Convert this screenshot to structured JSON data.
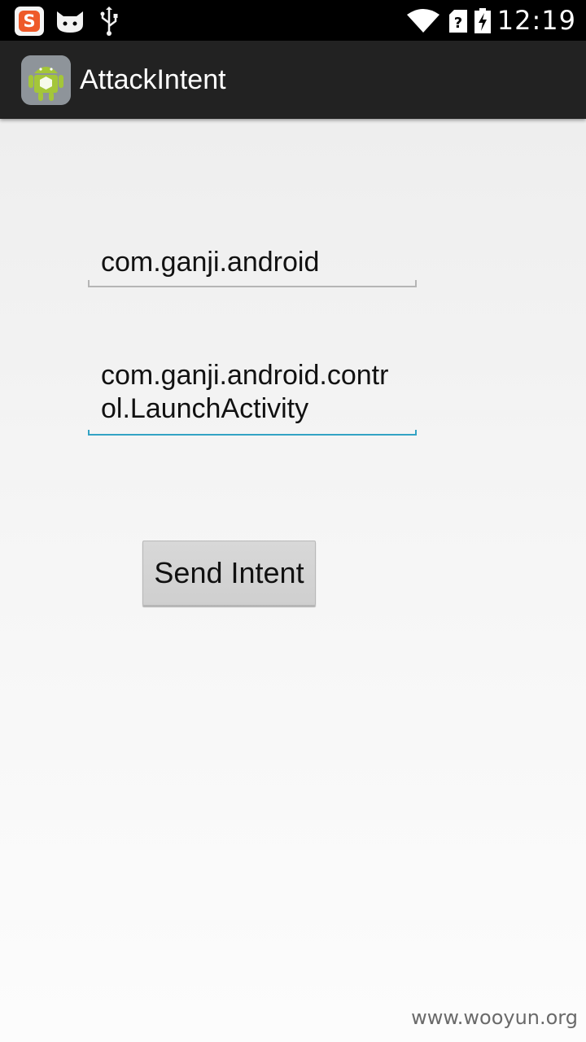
{
  "status_bar": {
    "time": "12:19",
    "ime_icon_glyph": "S",
    "icons": [
      "sogou-ime-icon",
      "cat-notification-icon",
      "usb-icon",
      "wifi-icon",
      "sim-unknown-icon",
      "battery-charging-icon"
    ]
  },
  "action_bar": {
    "title": "AttackIntent",
    "icon": "android-app-icon"
  },
  "form": {
    "package_name": "com.ganji.android",
    "activity_name": "com.ganji.android.control.LaunchActivity",
    "send_button_label": "Send Intent"
  },
  "watermark": "www.wooyun.org",
  "colors": {
    "status_bar": "#000000",
    "action_bar": "#222222",
    "focus_accent": "#33a3c4",
    "button": "#d4d4d4"
  }
}
